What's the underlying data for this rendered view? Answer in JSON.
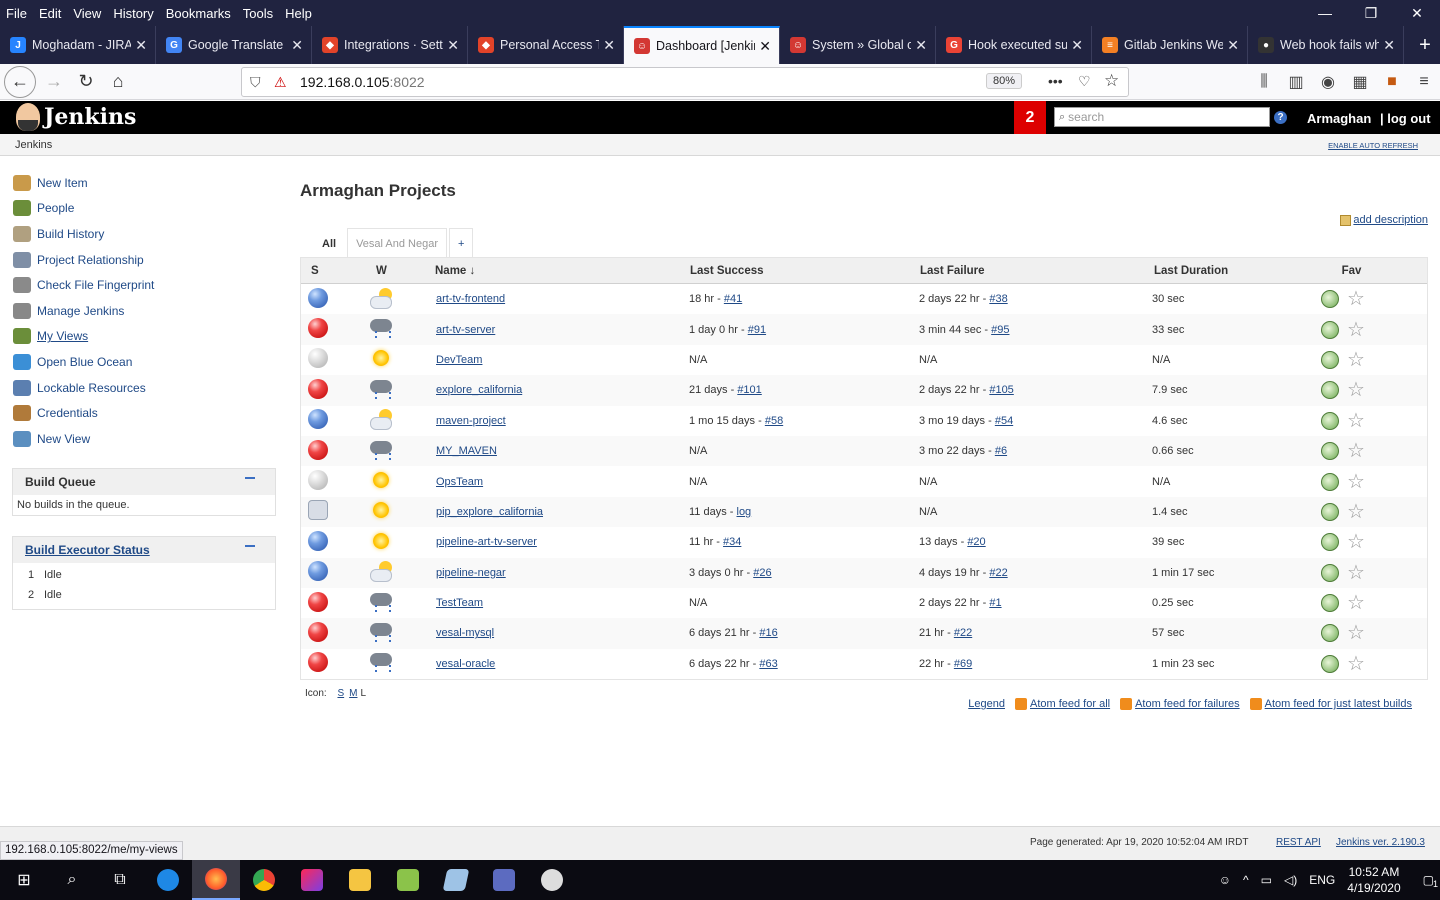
{
  "browser": {
    "menu": [
      "File",
      "Edit",
      "View",
      "History",
      "Bookmarks",
      "Tools",
      "Help"
    ],
    "tabs": [
      {
        "title": "Moghadam - JIRA",
        "color": "#2684ff",
        "icon": "J"
      },
      {
        "title": "Google Translate",
        "color": "#4285f4",
        "icon": "G"
      },
      {
        "title": "Integrations · Setti",
        "color": "#e24329",
        "icon": "◆"
      },
      {
        "title": "Personal Access To",
        "color": "#e24329",
        "icon": "◆"
      },
      {
        "title": "Dashboard [Jenkin",
        "color": "#d33833",
        "icon": "☺"
      },
      {
        "title": "System » Global cr",
        "color": "#d33833",
        "icon": "☺"
      },
      {
        "title": "Hook executed su",
        "color": "#ea4335",
        "icon": "G"
      },
      {
        "title": "Gitlab Jenkins Wel",
        "color": "#f48024",
        "icon": "≡"
      },
      {
        "title": "Web hook fails wh",
        "color": "#333333",
        "icon": "●"
      }
    ],
    "active_tab": 4,
    "url_host": "192.168.0.105",
    "url_port": ":8022",
    "zoom": "80%",
    "status_url": "192.168.0.105:8022/me/my-views"
  },
  "jenkins": {
    "title": "Jenkins",
    "notifications": "2",
    "search_placeholder": "search",
    "user": "Armaghan",
    "logout": "| log out",
    "breadcrumb": "Jenkins",
    "auto_refresh": "ENABLE AUTO REFRESH"
  },
  "sidebar": {
    "tasks": [
      {
        "label": "New Item",
        "icon": "new-item-icon",
        "color": "#c99a4a",
        "underline": false
      },
      {
        "label": "People",
        "icon": "people-icon",
        "color": "#6b8e3a",
        "underline": false
      },
      {
        "label": "Build History",
        "icon": "build-history-icon",
        "color": "#b0a080",
        "underline": false
      },
      {
        "label": "Project Relationship",
        "icon": "project-relationship-icon",
        "color": "#7f8fa6",
        "underline": false
      },
      {
        "label": "Check File Fingerprint",
        "icon": "fingerprint-icon",
        "color": "#8a8a8a",
        "underline": false
      },
      {
        "label": "Manage Jenkins",
        "icon": "gear-icon",
        "color": "#888888",
        "underline": false
      },
      {
        "label": "My Views",
        "icon": "my-views-icon",
        "color": "#6b8e3a",
        "underline": true
      },
      {
        "label": "Open Blue Ocean",
        "icon": "blue-ocean-icon",
        "color": "#3b8fd6",
        "underline": false
      },
      {
        "label": "Lockable Resources",
        "icon": "lock-icon",
        "color": "#5b7fb0",
        "underline": false
      },
      {
        "label": "Credentials",
        "icon": "credentials-icon",
        "color": "#b07a3a",
        "underline": false
      },
      {
        "label": "New View",
        "icon": "folder-icon",
        "color": "#5b8fc0",
        "underline": false
      }
    ],
    "build_queue": {
      "title": "Build Queue",
      "empty": "No builds in the queue."
    },
    "executors": {
      "title": "Build Executor Status",
      "items": [
        {
          "num": "1",
          "status": "Idle"
        },
        {
          "num": "2",
          "status": "Idle"
        }
      ]
    }
  },
  "main": {
    "title": "Armaghan Projects",
    "add_description": "add description",
    "view_tabs": [
      "All",
      "Vesal And Negar",
      "+"
    ],
    "columns": {
      "s": "S",
      "w": "W",
      "name": "Name ↓",
      "last_success": "Last Success",
      "last_failure": "Last Failure",
      "last_duration": "Last Duration",
      "fav": "Fav"
    },
    "jobs": [
      {
        "status": "blue",
        "weather": "cloudsun",
        "name": "art-tv-frontend",
        "ls_text": "18 hr - ",
        "ls_link": "#41",
        "lf_text": "2 days 22 hr - ",
        "lf_link": "#38",
        "duration": "30 sec"
      },
      {
        "status": "red",
        "weather": "storm",
        "name": "art-tv-server",
        "ls_text": "1 day 0 hr - ",
        "ls_link": "#91",
        "lf_text": "3 min 44 sec - ",
        "lf_link": "#95",
        "duration": "33 sec"
      },
      {
        "status": "grey",
        "weather": "sun",
        "name": "DevTeam",
        "ls_text": "N/A",
        "ls_link": "",
        "lf_text": "N/A",
        "lf_link": "",
        "duration": "N/A"
      },
      {
        "status": "red",
        "weather": "storm",
        "name": "explore_california",
        "ls_text": "21 days - ",
        "ls_link": "#101",
        "lf_text": "2 days 22 hr - ",
        "lf_link": "#105",
        "duration": "7.9 sec"
      },
      {
        "status": "blue",
        "weather": "cloudsun",
        "name": "maven-project",
        "ls_text": "1 mo 15 days - ",
        "ls_link": "#58",
        "lf_text": "3 mo 19 days - ",
        "lf_link": "#54",
        "duration": "4.6 sec"
      },
      {
        "status": "red",
        "weather": "storm",
        "name": "MY_MAVEN",
        "ls_text": "N/A",
        "ls_link": "",
        "lf_text": "3 mo 22 days - ",
        "lf_link": "#6",
        "duration": "0.66 sec"
      },
      {
        "status": "grey",
        "weather": "sun",
        "name": "OpsTeam",
        "ls_text": "N/A",
        "ls_link": "",
        "lf_text": "N/A",
        "lf_link": "",
        "duration": "N/A"
      },
      {
        "status": "folder",
        "weather": "sun",
        "name": "pip_explore_california",
        "ls_text": "11 days - ",
        "ls_link": "log",
        "lf_text": "N/A",
        "lf_link": "",
        "duration": "1.4 sec"
      },
      {
        "status": "blue",
        "weather": "sun",
        "name": "pipeline-art-tv-server",
        "ls_text": "11 hr - ",
        "ls_link": "#34",
        "lf_text": "13 days - ",
        "lf_link": "#20",
        "duration": "39 sec"
      },
      {
        "status": "blue",
        "weather": "cloudsun",
        "name": "pipeline-negar",
        "ls_text": "3 days 0 hr - ",
        "ls_link": "#26",
        "lf_text": "4 days 19 hr - ",
        "lf_link": "#22",
        "duration": "1 min 17 sec"
      },
      {
        "status": "red",
        "weather": "storm",
        "name": "TestTeam",
        "ls_text": "N/A",
        "ls_link": "",
        "lf_text": "2 days 22 hr - ",
        "lf_link": "#1",
        "duration": "0.25 sec"
      },
      {
        "status": "red",
        "weather": "storm",
        "name": "vesal-mysql",
        "ls_text": "6 days 21 hr - ",
        "ls_link": "#16",
        "lf_text": "21 hr - ",
        "lf_link": "#22",
        "duration": "57 sec"
      },
      {
        "status": "red",
        "weather": "storm",
        "name": "vesal-oracle",
        "ls_text": "6 days 22 hr - ",
        "ls_link": "#63",
        "lf_text": "22 hr - ",
        "lf_link": "#69",
        "duration": "1 min 23 sec"
      }
    ],
    "icon_label": "Icon:",
    "icon_sizes": [
      "S",
      "M",
      "L"
    ],
    "legend": "Legend",
    "feeds": [
      "Atom feed for all",
      "Atom feed for failures",
      "Atom feed for just latest builds"
    ]
  },
  "footer": {
    "generated": "Page generated: Apr 19, 2020 10:52:04 AM IRDT",
    "rest_api": "REST API",
    "version": "Jenkins ver. 2.190.3"
  },
  "taskbar": {
    "lang": "ENG",
    "time": "10:52 AM",
    "date": "4/19/2020",
    "notifications": "1"
  }
}
